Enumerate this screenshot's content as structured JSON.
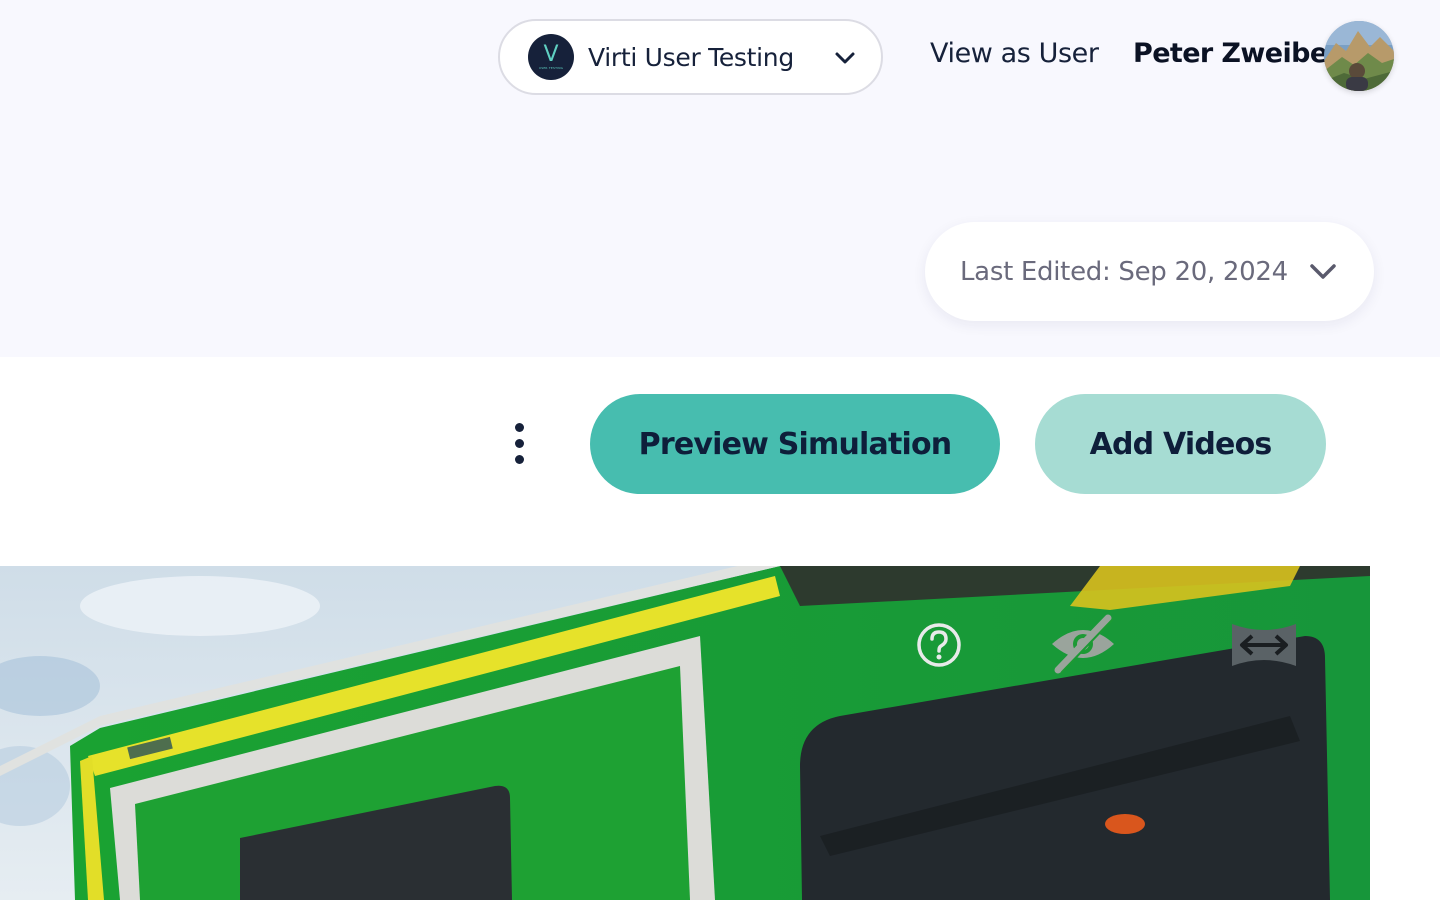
{
  "header": {
    "org_switcher": {
      "logo_letter": "V",
      "logo_subtext": "USER TESTING",
      "name": "Virti User Testing",
      "chevron_icon": "chevron-down-icon"
    },
    "view_as_user_label": "View as User",
    "user_name": "Peter Zweibel",
    "avatar_icon": "user-avatar-photo"
  },
  "last_edited": {
    "label": "Last Edited: Sep 20, 2024",
    "chevron_icon": "chevron-down-icon"
  },
  "toolbar": {
    "more_icon": "more-vertical-icon",
    "preview_label": "Preview Simulation",
    "add_videos_label": "Add Videos"
  },
  "viewer": {
    "icons": [
      "help-circle-icon",
      "eye-off-icon",
      "expand-horizontal-icon"
    ]
  },
  "colors": {
    "accent": "#47bdaf",
    "accent_light": "#a6dcd3",
    "text_dark": "#0e1e3a",
    "page_bg": "#f8f8fe"
  }
}
